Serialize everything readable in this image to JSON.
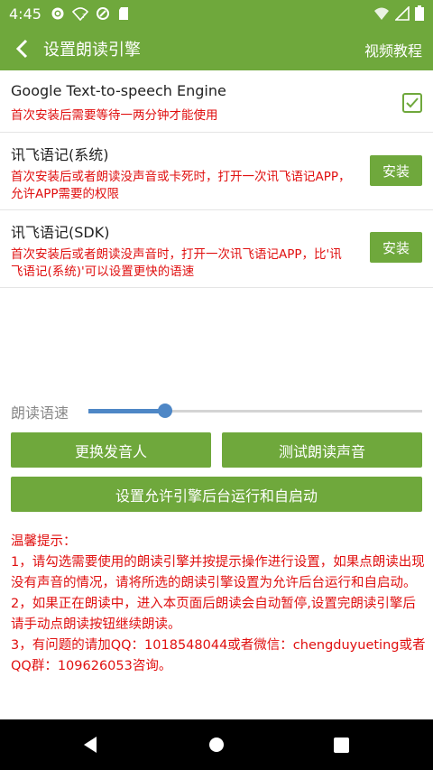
{
  "status_bar": {
    "time": "4:45"
  },
  "app_bar": {
    "title": "设置朗读引擎",
    "tutorial": "视频教程"
  },
  "engines": [
    {
      "name": "Google Text-to-speech Engine",
      "desc": "首次安装后需要等待一两分钟才能使用",
      "selected": true
    },
    {
      "name": "讯飞语记(系统)",
      "desc": "首次安装后或者朗读没声音或卡死时，打开一次讯飞语记APP，允许APP需要的权限",
      "action": "安装"
    },
    {
      "name": "讯飞语记(SDK)",
      "desc": "首次安装后或者朗读没声音时，打开一次讯飞语记APP，比'讯飞语记(系统)'可以设置更快的语速",
      "action": "安装"
    }
  ],
  "speed": {
    "label": "朗读语速",
    "value": 0.23
  },
  "buttons": {
    "change_voice": "更换发音人",
    "test_voice": "测试朗读声音",
    "allow_background": "设置允许引擎后台运行和自启动"
  },
  "tips": {
    "title": "温馨提示：",
    "lines": [
      "1，请勾选需要使用的朗读引擎并按提示操作进行设置，如果点朗读出现没有声音的情况，请将所选的朗读引擎设置为允许后台运行和自启动。",
      "2，如果正在朗读中，进入本页面后朗读会自动暂停,设置完朗读引擎后请手动点朗读按钮继续朗读。",
      "3，有问题的请加QQ：1018548044或者微信：chengduyueting或者QQ群：109626053咨询。"
    ]
  },
  "colors": {
    "accent": "#6fa83c",
    "warning_text": "#e01010",
    "slider": "#4e87c6"
  }
}
